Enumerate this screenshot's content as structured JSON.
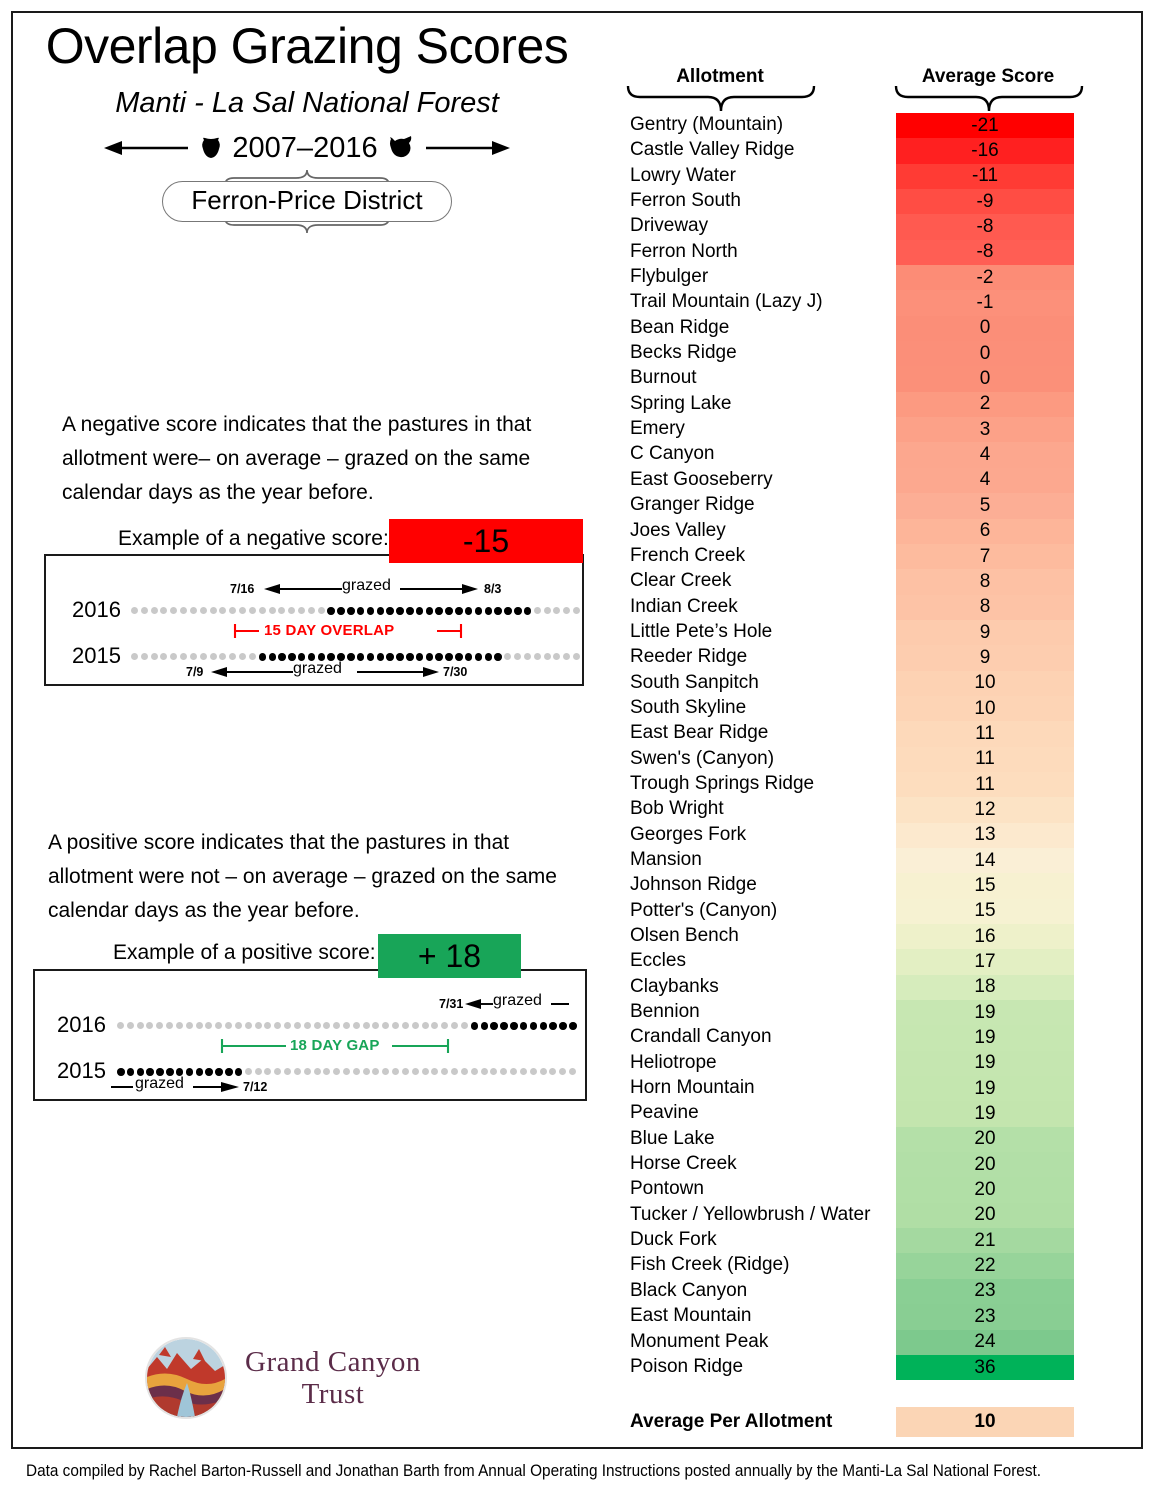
{
  "header": {
    "title": "Overlap Grazing Scores",
    "subtitle": "Manti - La Sal National Forest",
    "years": "2007–2016",
    "district": "Ferron-Price District",
    "left_arrow_icon": "arrow-left-icon",
    "right_arrow_icon": "arrow-right-icon",
    "cow_icon_left": "cow-silhouette-icon",
    "cow_icon_right": "cow-silhouette-icon"
  },
  "explanations": {
    "negative": {
      "text": "A negative score indicates that the pastures in that allotment were– on average – grazed on the same calendar days as the year before.",
      "example_label": "Example of a negative score:",
      "chip_value": "-15",
      "chip_color": "#FF0000",
      "year_top": "2016",
      "year_bottom": "2015",
      "top_start_date": "7/16",
      "top_end_date": "8/3",
      "bottom_start_date": "7/9",
      "bottom_end_date": "7/30",
      "grazed_label": "grazed",
      "span_label": "15 DAY OVERLAP",
      "span_color": "#FF0000"
    },
    "positive": {
      "text": "A positive score indicates that the pastures in that allotment were not – on average – grazed on the same calendar days as the year before.",
      "example_label": "Example of a positive score:",
      "chip_value": "+ 18",
      "chip_color": "#18A558",
      "year_top": "2016",
      "year_bottom": "2015",
      "top_start_date": "7/31",
      "bottom_end_date": "7/12",
      "grazed_label": "grazed",
      "span_label": "18 DAY GAP",
      "span_color": "#18A558"
    }
  },
  "logo": {
    "line1": "Grand Canyon",
    "line2": "Trust",
    "mark_icon": "canyon-landscape-icon",
    "color": "#5b2c49"
  },
  "footer": {
    "text": "Data compiled by Rachel Barton-Russell and Jonathan Barth from Annual Operating Instructions posted annually by the Manti-La Sal National Forest."
  },
  "chart_data": {
    "type": "table",
    "title": "Overlap Grazing Scores",
    "columns": [
      "Allotment",
      "Average Score"
    ],
    "categories": [
      "Gentry (Mountain)",
      "Castle Valley Ridge",
      "Lowry Water",
      "Ferron South",
      "Driveway",
      "Ferron North",
      "Flybulger",
      "Trail Mountain (Lazy J)",
      "Bean Ridge",
      "Becks Ridge",
      "Burnout",
      "Spring Lake",
      "Emery",
      "C Canyon",
      "East Gooseberry",
      "Granger Ridge",
      "Joes Valley",
      "French Creek",
      "Clear Creek",
      "Indian Creek",
      "Little Pete’s Hole",
      "Reeder Ridge",
      "South Sanpitch",
      "South Skyline",
      "East Bear Ridge",
      "Swen's (Canyon)",
      "Trough Springs Ridge",
      "Bob Wright",
      "Georges Fork",
      "Mansion",
      "Johnson Ridge",
      "Potter's (Canyon)",
      "Olsen Bench",
      "Eccles",
      "Claybanks",
      "Bennion",
      "Crandall Canyon",
      "Heliotrope",
      "Horn Mountain",
      "Peavine",
      "Blue Lake",
      "Horse Creek",
      "Pontown",
      "Tucker / Yellowbrush / Water",
      "Duck Fork",
      "Fish Creek (Ridge)",
      "Black Canyon",
      "East Mountain",
      "Monument Peak",
      "Poison Ridge"
    ],
    "values": [
      -21,
      -16,
      -11,
      -9,
      -8,
      -8,
      -2,
      -1,
      0,
      0,
      0,
      2,
      3,
      4,
      4,
      5,
      6,
      7,
      8,
      8,
      9,
      9,
      10,
      10,
      11,
      11,
      11,
      12,
      13,
      14,
      15,
      15,
      16,
      17,
      18,
      19,
      19,
      19,
      19,
      19,
      20,
      20,
      20,
      20,
      21,
      22,
      23,
      23,
      24,
      36
    ],
    "cell_colors": [
      "#FF0000",
      "#FF2020",
      "#FF3B34",
      "#FF4D44",
      "#FF5A50",
      "#FF5E54",
      "#FC8C76",
      "#FC907A",
      "#FB8E78",
      "#FB8F79",
      "#FB9079",
      "#FC9A81",
      "#FCA188",
      "#FCA78E",
      "#FCA88F",
      "#FCAE95",
      "#FDB599",
      "#FDBB9E",
      "#FDC1A4",
      "#FDC3A6",
      "#FDCBAD",
      "#FDCDAF",
      "#FDD2B3",
      "#FDD4B5",
      "#FDD9BA",
      "#FDDBBC",
      "#FDDDBE",
      "#FCE3C5",
      "#FCE9CE",
      "#FAEFD6",
      "#F7F1D1",
      "#F6F2D2",
      "#EEF1CA",
      "#E3EFC3",
      "#D6ECBC",
      "#C7E7B2",
      "#C6E7B1",
      "#C5E6B0",
      "#C4E6AF",
      "#C3E5AE",
      "#B4E0A8",
      "#B2DFA7",
      "#B1DFA6",
      "#B0DEA5",
      "#A4D9A0",
      "#97D49A",
      "#8ACF94",
      "#89CE93",
      "#7DC98D",
      "#00B259"
    ],
    "summary_row": {
      "label": "Average Per Allotment",
      "value": 10,
      "color": "#FBD5B5"
    },
    "colormap": "red-yellow-green diverging",
    "ylabel": "Average Score",
    "xlabel": "Allotment"
  }
}
